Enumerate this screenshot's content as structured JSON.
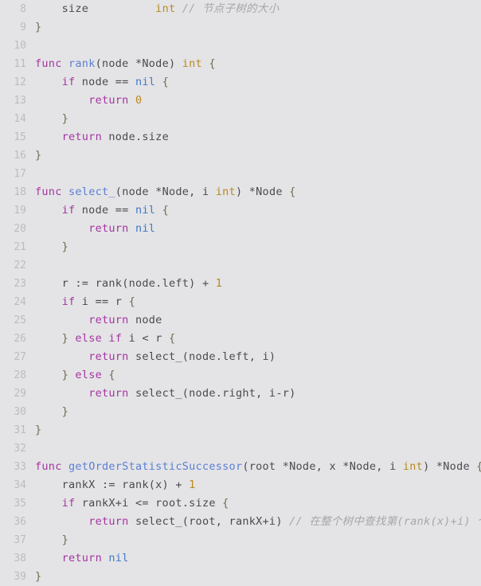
{
  "editor": {
    "language": "go",
    "background_color": "#e4e4e6",
    "gutter_color": "#bcbcc0",
    "first_line_number": 8,
    "last_line_number": 39,
    "theme_colors": {
      "keyword": "#a434a0",
      "function": "#5a7fd4",
      "type": "#b98a1e",
      "builtin": "#4078c8",
      "number": "#b98a1e",
      "punctuation": "#6d6d52",
      "identifier": "#4a4a50",
      "comment": "#a6a6ac"
    }
  },
  "lines": [
    {
      "n": "8",
      "text": "    size          int // 节点子树的大小"
    },
    {
      "n": "9",
      "text": "}"
    },
    {
      "n": "10",
      "text": ""
    },
    {
      "n": "11",
      "text": "func rank(node *Node) int {"
    },
    {
      "n": "12",
      "text": "    if node == nil {"
    },
    {
      "n": "13",
      "text": "        return 0"
    },
    {
      "n": "14",
      "text": "    }"
    },
    {
      "n": "15",
      "text": "    return node.size"
    },
    {
      "n": "16",
      "text": "}"
    },
    {
      "n": "17",
      "text": ""
    },
    {
      "n": "18",
      "text": "func select_(node *Node, i int) *Node {"
    },
    {
      "n": "19",
      "text": "    if node == nil {"
    },
    {
      "n": "20",
      "text": "        return nil"
    },
    {
      "n": "21",
      "text": "    }"
    },
    {
      "n": "22",
      "text": ""
    },
    {
      "n": "23",
      "text": "    r := rank(node.left) + 1"
    },
    {
      "n": "24",
      "text": "    if i == r {"
    },
    {
      "n": "25",
      "text": "        return node"
    },
    {
      "n": "26",
      "text": "    } else if i < r {"
    },
    {
      "n": "27",
      "text": "        return select_(node.left, i)"
    },
    {
      "n": "28",
      "text": "    } else {"
    },
    {
      "n": "29",
      "text": "        return select_(node.right, i-r)"
    },
    {
      "n": "30",
      "text": "    }"
    },
    {
      "n": "31",
      "text": "}"
    },
    {
      "n": "32",
      "text": ""
    },
    {
      "n": "33",
      "text": "func getOrderStatisticSuccessor(root *Node, x *Node, i int) *Node {"
    },
    {
      "n": "34",
      "text": "    rankX := rank(x) + 1"
    },
    {
      "n": "35",
      "text": "    if rankX+i <= root.size {"
    },
    {
      "n": "36",
      "text": "        return select_(root, rankX+i) // 在整个树中查找第(rank(x)+i) 个/"
    },
    {
      "n": "37",
      "text": "    }"
    },
    {
      "n": "38",
      "text": "    return nil"
    },
    {
      "n": "39",
      "text": "}"
    }
  ],
  "tokens": [
    [
      {
        "t": "    size          ",
        "c": "id"
      },
      {
        "t": "int",
        "c": "typ"
      },
      {
        "t": " ",
        "c": "id"
      },
      {
        "t": "// 节点子树的大小",
        "c": "cm"
      }
    ],
    [
      {
        "t": "}",
        "c": "pun"
      }
    ],
    [],
    [
      {
        "t": "func",
        "c": "kw"
      },
      {
        "t": " ",
        "c": "id"
      },
      {
        "t": "rank",
        "c": "fn"
      },
      {
        "t": "(node *Node) ",
        "c": "id"
      },
      {
        "t": "int",
        "c": "typ"
      },
      {
        "t": " ",
        "c": "id"
      },
      {
        "t": "{",
        "c": "pun"
      }
    ],
    [
      {
        "t": "    ",
        "c": "id"
      },
      {
        "t": "if",
        "c": "kw"
      },
      {
        "t": " node == ",
        "c": "id"
      },
      {
        "t": "nil",
        "c": "blt"
      },
      {
        "t": " ",
        "c": "id"
      },
      {
        "t": "{",
        "c": "pun"
      }
    ],
    [
      {
        "t": "        ",
        "c": "id"
      },
      {
        "t": "return",
        "c": "kw"
      },
      {
        "t": " ",
        "c": "id"
      },
      {
        "t": "0",
        "c": "num"
      }
    ],
    [
      {
        "t": "    ",
        "c": "id"
      },
      {
        "t": "}",
        "c": "pun"
      }
    ],
    [
      {
        "t": "    ",
        "c": "id"
      },
      {
        "t": "return",
        "c": "kw"
      },
      {
        "t": " node.size",
        "c": "id"
      }
    ],
    [
      {
        "t": "}",
        "c": "pun"
      }
    ],
    [],
    [
      {
        "t": "func",
        "c": "kw"
      },
      {
        "t": " ",
        "c": "id"
      },
      {
        "t": "select_",
        "c": "fn"
      },
      {
        "t": "(node *Node, i ",
        "c": "id"
      },
      {
        "t": "int",
        "c": "typ"
      },
      {
        "t": ") *Node ",
        "c": "id"
      },
      {
        "t": "{",
        "c": "pun"
      }
    ],
    [
      {
        "t": "    ",
        "c": "id"
      },
      {
        "t": "if",
        "c": "kw"
      },
      {
        "t": " node == ",
        "c": "id"
      },
      {
        "t": "nil",
        "c": "blt"
      },
      {
        "t": " ",
        "c": "id"
      },
      {
        "t": "{",
        "c": "pun"
      }
    ],
    [
      {
        "t": "        ",
        "c": "id"
      },
      {
        "t": "return",
        "c": "kw"
      },
      {
        "t": " ",
        "c": "id"
      },
      {
        "t": "nil",
        "c": "blt"
      }
    ],
    [
      {
        "t": "    ",
        "c": "id"
      },
      {
        "t": "}",
        "c": "pun"
      }
    ],
    [],
    [
      {
        "t": "    r := ",
        "c": "id"
      },
      {
        "t": "rank",
        "c": "id"
      },
      {
        "t": "(node.left) + ",
        "c": "id"
      },
      {
        "t": "1",
        "c": "num"
      }
    ],
    [
      {
        "t": "    ",
        "c": "id"
      },
      {
        "t": "if",
        "c": "kw"
      },
      {
        "t": " i == r ",
        "c": "id"
      },
      {
        "t": "{",
        "c": "pun"
      }
    ],
    [
      {
        "t": "        ",
        "c": "id"
      },
      {
        "t": "return",
        "c": "kw"
      },
      {
        "t": " node",
        "c": "id"
      }
    ],
    [
      {
        "t": "    ",
        "c": "id"
      },
      {
        "t": "}",
        "c": "pun"
      },
      {
        "t": " ",
        "c": "id"
      },
      {
        "t": "else",
        "c": "kw"
      },
      {
        "t": " ",
        "c": "id"
      },
      {
        "t": "if",
        "c": "kw"
      },
      {
        "t": " i < r ",
        "c": "id"
      },
      {
        "t": "{",
        "c": "pun"
      }
    ],
    [
      {
        "t": "        ",
        "c": "id"
      },
      {
        "t": "return",
        "c": "kw"
      },
      {
        "t": " select_(node.left, i)",
        "c": "id"
      }
    ],
    [
      {
        "t": "    ",
        "c": "id"
      },
      {
        "t": "}",
        "c": "pun"
      },
      {
        "t": " ",
        "c": "id"
      },
      {
        "t": "else",
        "c": "kw"
      },
      {
        "t": " ",
        "c": "id"
      },
      {
        "t": "{",
        "c": "pun"
      }
    ],
    [
      {
        "t": "        ",
        "c": "id"
      },
      {
        "t": "return",
        "c": "kw"
      },
      {
        "t": " select_(node.right, i-r)",
        "c": "id"
      }
    ],
    [
      {
        "t": "    ",
        "c": "id"
      },
      {
        "t": "}",
        "c": "pun"
      }
    ],
    [
      {
        "t": "}",
        "c": "pun"
      }
    ],
    [],
    [
      {
        "t": "func",
        "c": "kw"
      },
      {
        "t": " ",
        "c": "id"
      },
      {
        "t": "getOrderStatisticSuccessor",
        "c": "fn"
      },
      {
        "t": "(root *Node, x *Node, i ",
        "c": "id"
      },
      {
        "t": "int",
        "c": "typ"
      },
      {
        "t": ") *Node ",
        "c": "id"
      },
      {
        "t": "{",
        "c": "pun"
      }
    ],
    [
      {
        "t": "    rankX := ",
        "c": "id"
      },
      {
        "t": "rank",
        "c": "id"
      },
      {
        "t": "(x) + ",
        "c": "id"
      },
      {
        "t": "1",
        "c": "num"
      }
    ],
    [
      {
        "t": "    ",
        "c": "id"
      },
      {
        "t": "if",
        "c": "kw"
      },
      {
        "t": " rankX+i <= root.size ",
        "c": "id"
      },
      {
        "t": "{",
        "c": "pun"
      }
    ],
    [
      {
        "t": "        ",
        "c": "id"
      },
      {
        "t": "return",
        "c": "kw"
      },
      {
        "t": " select_(root, rankX+i) ",
        "c": "id"
      },
      {
        "t": "// 在整个树中查找第(rank(x)+i) 个/",
        "c": "cm"
      }
    ],
    [
      {
        "t": "    ",
        "c": "id"
      },
      {
        "t": "}",
        "c": "pun"
      }
    ],
    [
      {
        "t": "    ",
        "c": "id"
      },
      {
        "t": "return",
        "c": "kw"
      },
      {
        "t": " ",
        "c": "id"
      },
      {
        "t": "nil",
        "c": "blt"
      }
    ],
    [
      {
        "t": "}",
        "c": "pun"
      }
    ]
  ]
}
